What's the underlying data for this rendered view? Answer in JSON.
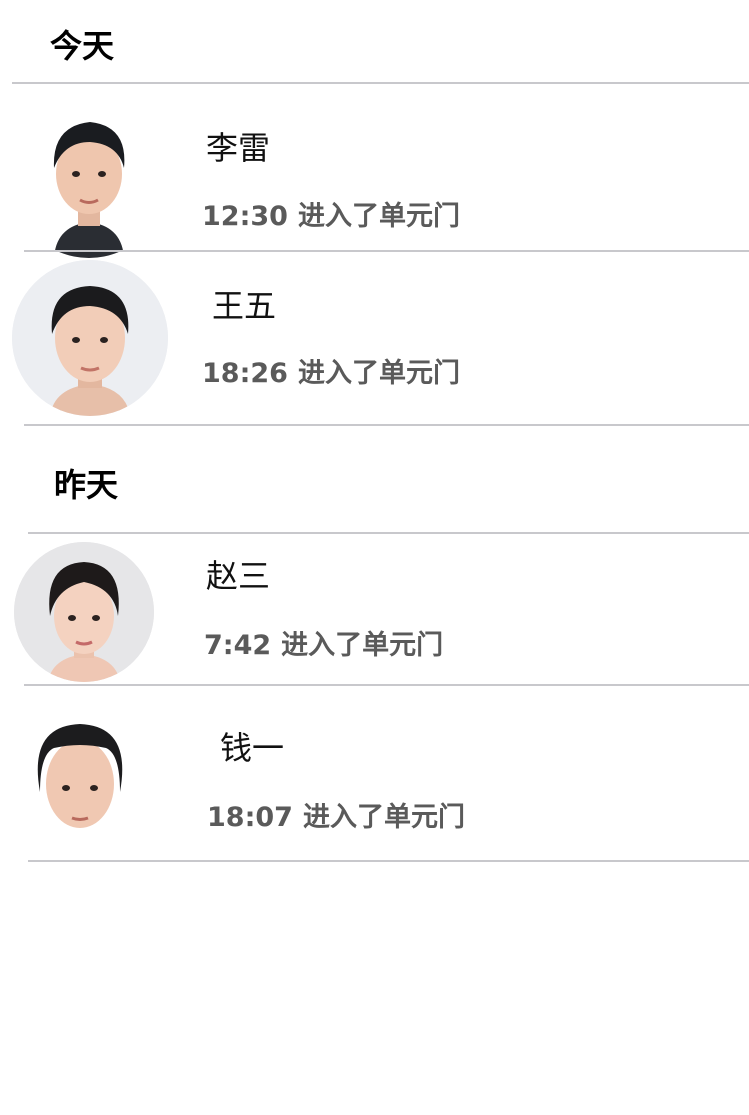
{
  "sections": [
    {
      "title": "今天",
      "entries": [
        {
          "name": "李雷",
          "time": "12:30",
          "action": "进入了单元门"
        },
        {
          "name": "王五",
          "time": "18:26",
          "action": "进入了单元门"
        }
      ]
    },
    {
      "title": "昨天",
      "entries": [
        {
          "name": "赵三",
          "time": "7:42",
          "action": "进入了单元门"
        },
        {
          "name": "钱一",
          "time": "18:07",
          "action": "进入了单元门"
        }
      ]
    }
  ]
}
